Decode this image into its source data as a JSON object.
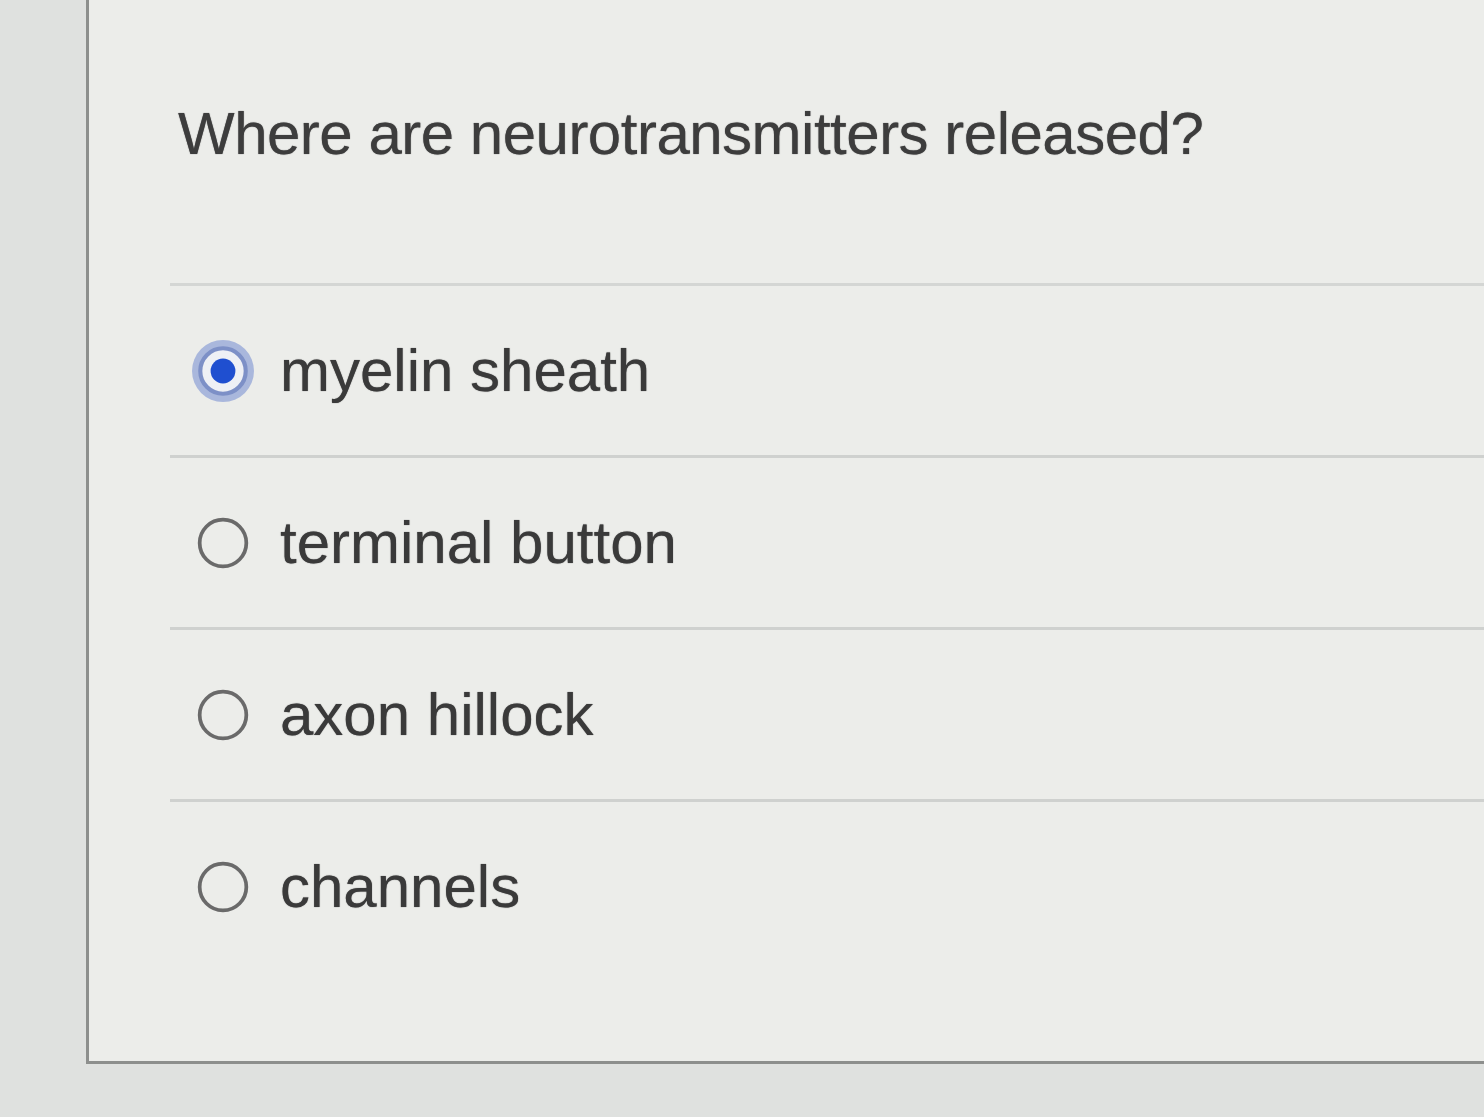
{
  "question": "Where are neurotransmitters released?",
  "options": [
    {
      "label": "myelin sheath",
      "selected": true
    },
    {
      "label": "terminal button",
      "selected": false
    },
    {
      "label": "axon hillock",
      "selected": false
    },
    {
      "label": "channels",
      "selected": false
    }
  ]
}
